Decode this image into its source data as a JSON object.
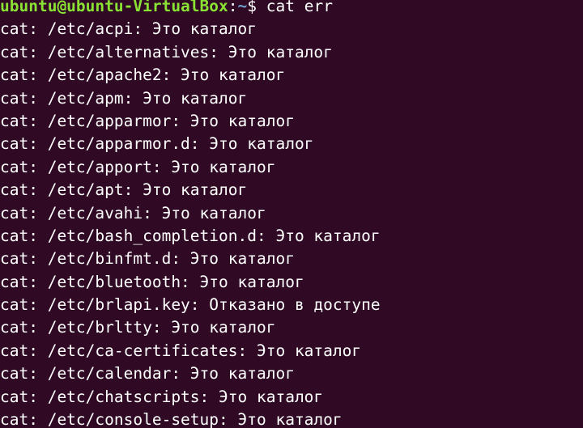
{
  "terminal": {
    "prompt": {
      "user_host": "ubuntu@ubuntu-VirtualBox",
      "sep": ":",
      "path": "~",
      "symbol": "$ ",
      "command": "cat err"
    },
    "output": [
      "cat: /etc/acpi: Это каталог",
      "cat: /etc/alternatives: Это каталог",
      "cat: /etc/apache2: Это каталог",
      "cat: /etc/apm: Это каталог",
      "cat: /etc/apparmor: Это каталог",
      "cat: /etc/apparmor.d: Это каталог",
      "cat: /etc/apport: Это каталог",
      "cat: /etc/apt: Это каталог",
      "cat: /etc/avahi: Это каталог",
      "cat: /etc/bash_completion.d: Это каталог",
      "cat: /etc/binfmt.d: Это каталог",
      "cat: /etc/bluetooth: Это каталог",
      "cat: /etc/brlapi.key: Отказано в доступе",
      "cat: /etc/brltty: Это каталог",
      "cat: /etc/ca-certificates: Это каталог",
      "cat: /etc/calendar: Это каталог",
      "cat: /etc/chatscripts: Это каталог",
      "cat: /etc/console-setup: Это каталог"
    ],
    "colors": {
      "background": "#300a24",
      "text": "#ffffff",
      "user_host": "#8ae234",
      "path": "#729fcf"
    }
  }
}
